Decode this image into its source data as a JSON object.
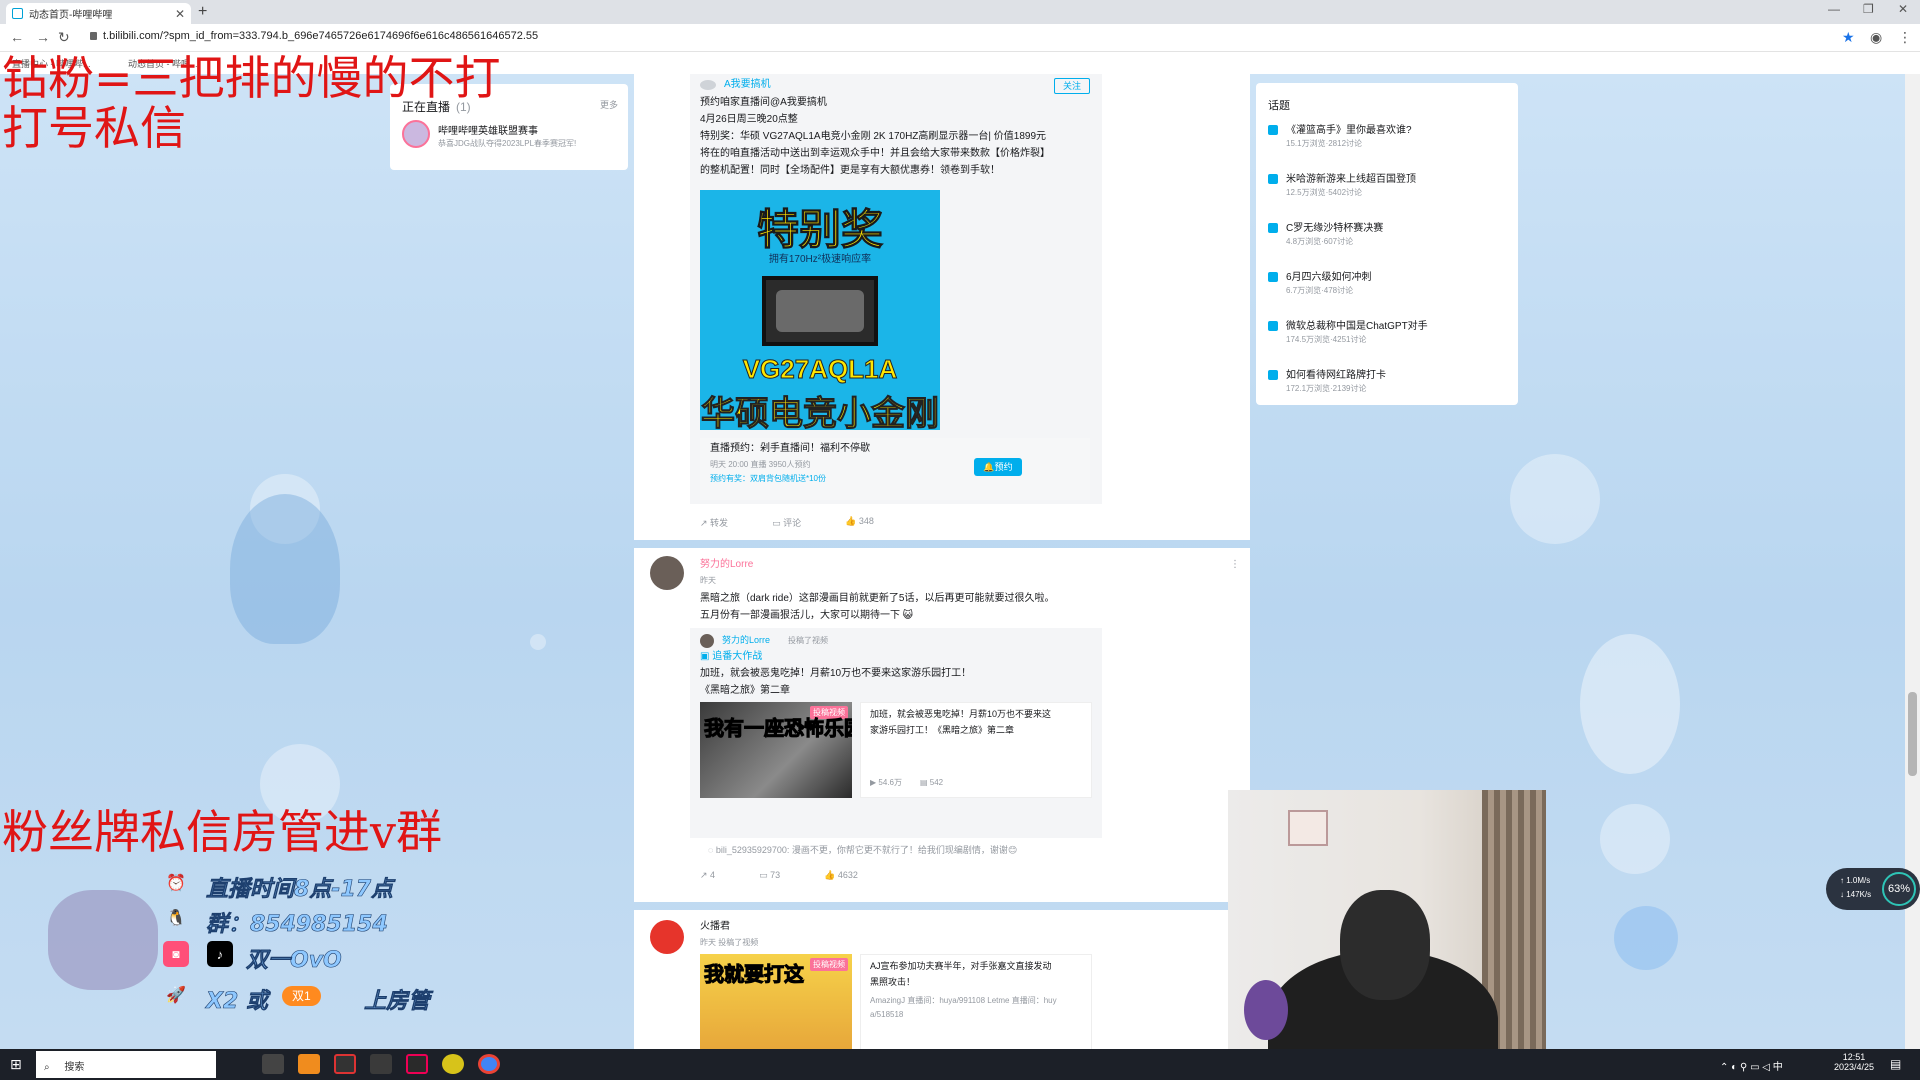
{
  "browser": {
    "tab_title": "动态首页-哔哩哔哩",
    "close_symbol": "✕",
    "new_tab_symbol": "+",
    "url": "t.bilibili.com/?spm_id_from=333.794.b_696e7465726e6174696f6e616c486561646572.55",
    "bookmarks": [
      "直播中心 - 哔哩哔...",
      "动态首页 - 哔哩..."
    ]
  },
  "live_panel": {
    "title": "正在直播",
    "count": "(1)",
    "more": "更多",
    "item_title": "哔哩哔哩英雄联盟赛事",
    "item_sub": "恭喜JDG战队夺得2023LPL春季赛冠军!"
  },
  "post1": {
    "author": "A我要搞机",
    "follow": "关注",
    "line1": "预约咱家直播间@A我要搞机",
    "line2": "4月26日周三晚20点整",
    "line3": "特别奖：华硕 VG27AQL1A电竞小金刚 2K 170HZ高刷显示器一台| 价值1899元",
    "line4": "将在的咱直播活动中送出到幸运观众手中！并且会给大家带来数款【价格炸裂】",
    "line5": "的整机配置！同时【全场配件】更是享有大额优惠券！领卷到手软！",
    "promo_head": "特别奖",
    "promo_sub": "拥有170Hz²极速响应率",
    "promo_model": "VG27AQL1A",
    "promo_cn": "华硕电竞小金刚",
    "resv_title": "直播预约：剁手直播间！福利不停歇",
    "resv_meta": "明天 20:00 直播   3950人预约",
    "resv_prize": "预约有奖：双肩背包随机送*10份",
    "resv_btn": "预约",
    "forward": "转发",
    "comment": "评论",
    "likes": "348"
  },
  "post2": {
    "author": "努力的Lorre",
    "time": "昨天",
    "text1": "黑暗之旅（dark ride）这部漫画目前就更新了5话，以后再更可能就要过很久啦。",
    "text2": "五月份有一部漫画狠活儿，大家可以期待一下",
    "inner_author": "努力的Lorre",
    "inner_action": "投稿了视频",
    "inner_topic": "追番大作战",
    "inner_text1": "加班，就会被恶鬼吃掉！月薪10万也不要来这家游乐园打工！",
    "inner_text2": "《黑暗之旅》第二章",
    "thumb_text": "我有一座恐怖乐园",
    "thumb_tag": "投稿视频",
    "vid_title1": "加班，就会被恶鬼吃掉！月薪10万也不要来这",
    "vid_title2": "家游乐园打工！《黑暗之旅》第二章",
    "vid_views": "54.6万",
    "vid_danmaku": "542",
    "top_comment": "bili_52935929700: 漫画不更，你帮它更不就行了！给我们现编剧情，谢谢😊",
    "forwards": "4",
    "comments": "73",
    "likes": "4632"
  },
  "post3": {
    "author": "火播君",
    "time": "昨天",
    "action": "投稿了视频",
    "thumb_text": "我就要打这",
    "thumb_tag": "投稿视频",
    "title1": "AJ宣布参加功夫赛半年，对手张嘉文直接发动",
    "title2": "黑照攻击！",
    "desc1": "AmazingJ 直播间：huya/991108 Letme 直播间：huy",
    "desc2": "a/518518"
  },
  "topics": {
    "title": "话题",
    "items": [
      {
        "name": "《灌篮高手》里你最喜欢谁?",
        "stats": "15.1万浏览·2812讨论"
      },
      {
        "name": "米哈游新游来上线超百国登顶",
        "stats": "12.5万浏览·5402讨论"
      },
      {
        "name": "C罗无缘沙特杯赛决赛",
        "stats": "4.8万浏览·607讨论"
      },
      {
        "name": "6月四六级如何冲刺",
        "stats": "6.7万浏览·478讨论"
      },
      {
        "name": "微软总裁称中国是ChatGPT对手",
        "stats": "174.5万浏览·4251讨论"
      },
      {
        "name": "如何看待网红路牌打卡",
        "stats": "172.1万浏览·2139讨论"
      }
    ]
  },
  "overlay": {
    "red_line1": "钻粉=三把排的慢的不打",
    "red_line2": "打号私信",
    "red_line3": "粉丝牌私信房管进v群",
    "info_time": "直播时间8点-17点",
    "info_group": "群：854985154",
    "info_douyin": "双一OvO",
    "info_x2": "X2 或",
    "info_badge": "双1",
    "info_manager": "上房管"
  },
  "net_widget": {
    "up": "1.0M/s",
    "down": "147K/s",
    "percent": "63%"
  },
  "taskbar": {
    "search": "搜索",
    "time": "12:51",
    "date": "2023/4/25",
    "ime": "中"
  }
}
